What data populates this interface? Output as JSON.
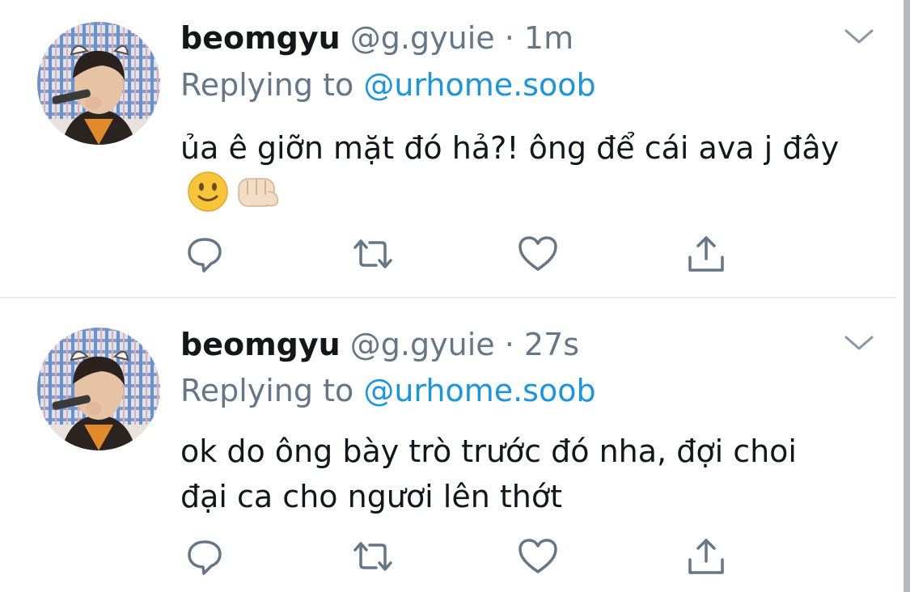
{
  "colors": {
    "text_primary": "#14171a",
    "text_secondary": "#657786",
    "link": "#1b95e0",
    "divider": "#e6ecf0"
  },
  "tweets": [
    {
      "name": "beomgyu",
      "handle": "@g.gyuie",
      "separator": "·",
      "time": "1m",
      "replying_prefix": "Replying to",
      "replying_to": "@urhome.soob",
      "text": "ủa ê giỡn mặt đó hả?! ông để cái ava j đây",
      "emojis": [
        "slightly-smiling-face",
        "fist-bump"
      ],
      "actions": [
        "reply-icon",
        "retweet-icon",
        "like-icon",
        "share-icon"
      ]
    },
    {
      "name": "beomgyu",
      "handle": "@g.gyuie",
      "separator": "·",
      "time": "27s",
      "replying_prefix": "Replying to",
      "replying_to": "@urhome.soob",
      "text": "ok do ông bày trò trước đó nha, đợi choi đại ca cho ngươi lên thớt",
      "actions": [
        "reply-icon",
        "retweet-icon",
        "like-icon",
        "share-icon"
      ]
    }
  ]
}
